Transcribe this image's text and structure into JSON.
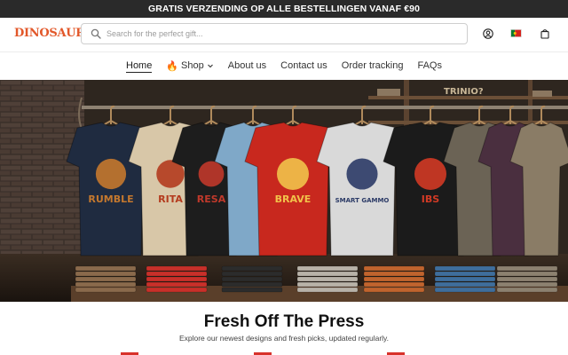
{
  "promo": {
    "text": "GRATIS VERZENDING OP ALLE BESTELLINGEN VANAF €90"
  },
  "header": {
    "logo": "DINOSAURIZE",
    "search_placeholder": "Search for the perfect gift...",
    "icons": [
      "account-icon",
      "flag-icon",
      "cart-icon"
    ]
  },
  "nav": {
    "items": [
      {
        "label": "Home",
        "active": true
      },
      {
        "label": "Shop",
        "icon": "fire-icon",
        "dropdown": true
      },
      {
        "label": "About us"
      },
      {
        "label": "Contact us"
      },
      {
        "label": "Order tracking"
      },
      {
        "label": "FAQs"
      }
    ]
  },
  "hero": {
    "wall_sign": "TRINIO?",
    "shirts": [
      {
        "color": "#1f2b40",
        "print": "#c4782e",
        "text": "RUMBLE"
      },
      {
        "color": "#d8c7a8",
        "print": "#b43b1e",
        "text": "RITA"
      },
      {
        "color": "#1d1d1d",
        "print": "#c0392b",
        "text": "RESA"
      },
      {
        "color": "#7fa8c8",
        "print": "#203040",
        "text": ""
      },
      {
        "color": "#c8281e",
        "print": "#f1c24a",
        "text": "BRAVE"
      },
      {
        "color": "#d9d9d9",
        "print": "#2b3a66",
        "text": "SMART GAMMO"
      },
      {
        "color": "#1b1b1b",
        "print": "#d23a25",
        "text": "IBS"
      },
      {
        "color": "#6b6355",
        "print": "#3a352c",
        "text": ""
      },
      {
        "color": "#4a2f3f",
        "print": "#2a1c24",
        "text": ""
      },
      {
        "color": "#8a7c66",
        "print": "#5c5141",
        "text": ""
      }
    ]
  },
  "section": {
    "title": "Fresh Off The Press",
    "subtitle": "Explore our newest designs and fresh picks, updated regularly."
  },
  "colors": {
    "accent": "#e2582a",
    "promo_bg": "#2a2a2a",
    "mark": "#d8322b"
  }
}
